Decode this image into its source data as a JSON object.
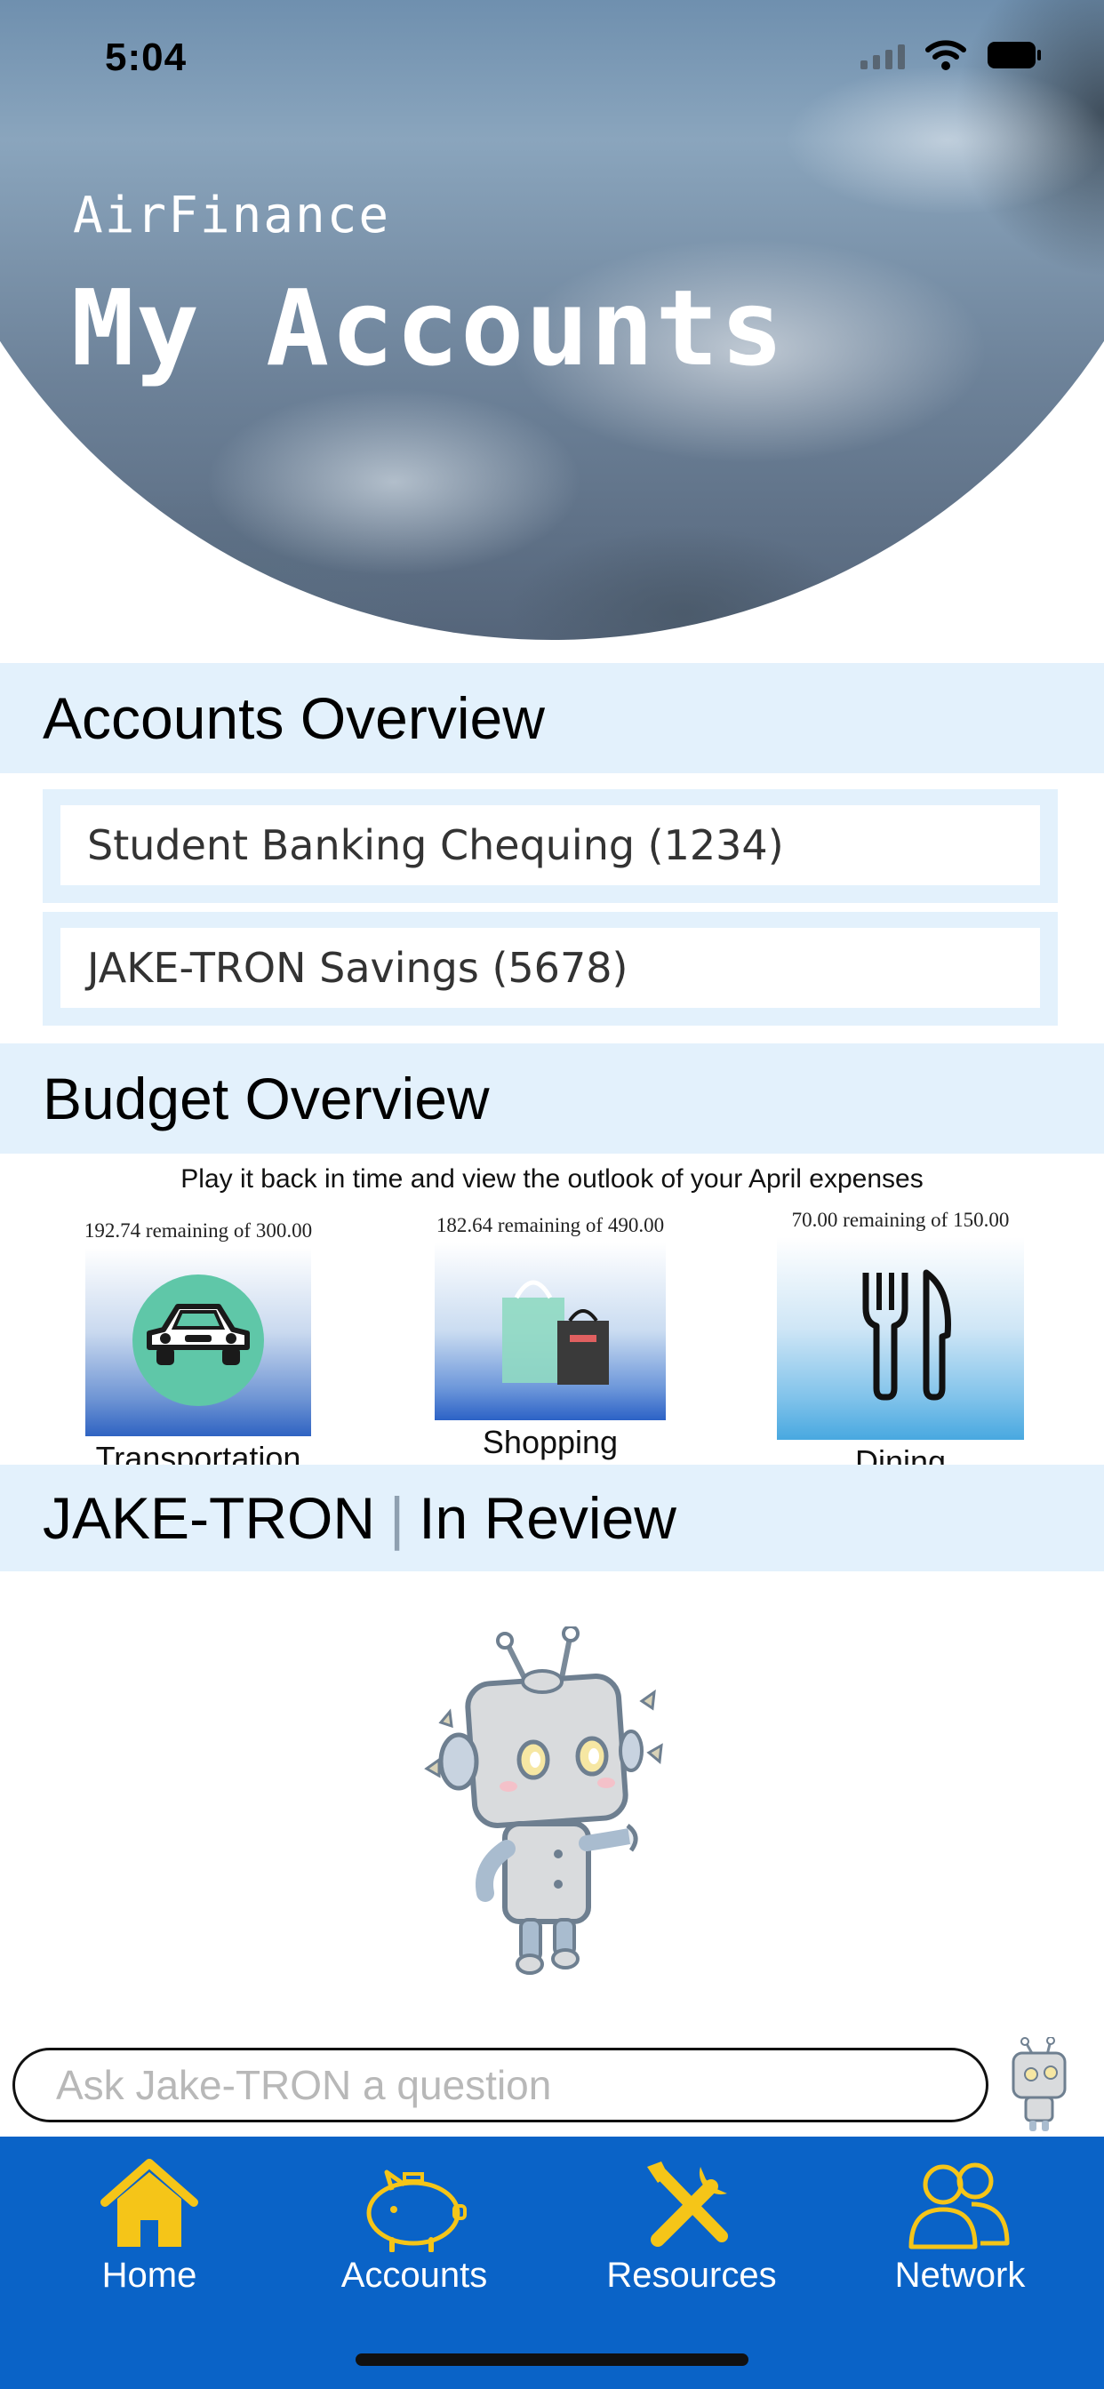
{
  "status_bar": {
    "time": "5:04"
  },
  "hero": {
    "app_name": "AirFinance",
    "title": "My Accounts"
  },
  "accounts_overview": {
    "title": "Accounts Overview",
    "accounts": [
      {
        "label": "Student Banking Chequing (1234)"
      },
      {
        "label": "JAKE-TRON Savings (5678)"
      }
    ]
  },
  "budget_overview": {
    "title": "Budget Overview",
    "subtitle": "Play it back in time and view the outlook of your April expenses",
    "categories": [
      {
        "name": "Transportation",
        "remaining_text": "192.74 remaining of 300.00",
        "remaining": 192.74,
        "total": 300.0,
        "icon": "car-icon"
      },
      {
        "name": "Shopping",
        "remaining_text": "182.64 remaining of 490.00",
        "remaining": 182.64,
        "total": 490.0,
        "icon": "shopping-bag-icon"
      },
      {
        "name": "Dining",
        "remaining_text": "70.00 remaining of 150.00",
        "remaining": 70.0,
        "total": 150.0,
        "icon": "fork-knife-icon"
      }
    ]
  },
  "review": {
    "brand": "JAKE-TRON",
    "separator": "|",
    "label": "In Review"
  },
  "ask": {
    "placeholder": "Ask Jake-TRON a question"
  },
  "tabbar": {
    "items": [
      {
        "label": "Home",
        "icon": "home-icon",
        "active": true
      },
      {
        "label": "Accounts",
        "icon": "piggy-bank-icon"
      },
      {
        "label": "Resources",
        "icon": "tools-icon"
      },
      {
        "label": "Network",
        "icon": "people-icon"
      }
    ]
  },
  "colors": {
    "section_bg": "#e3f1fc",
    "tabbar_bg": "#0a63c7",
    "tab_icon": "#f5c518"
  }
}
